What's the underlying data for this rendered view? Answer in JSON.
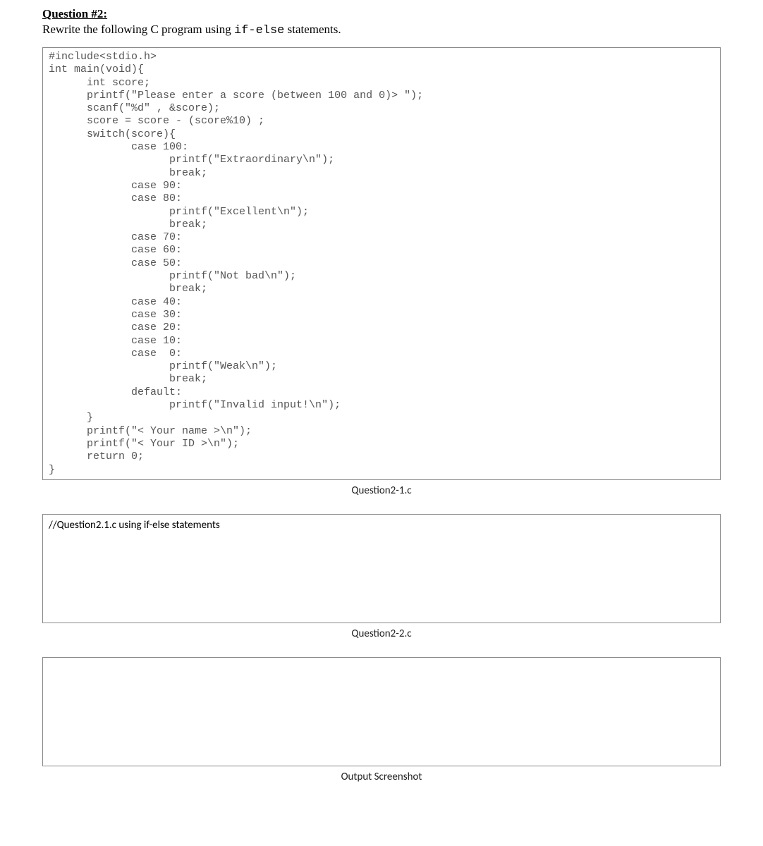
{
  "question": {
    "title": "Question #2:",
    "instruction_prefix": "Rewrite the following C program using ",
    "instruction_mono": "if-else",
    "instruction_suffix": " statements."
  },
  "code_block": "#include<stdio.h>\nint main(void){\n      int score;\n      printf(\"Please enter a score (between 100 and 0)> \");\n      scanf(\"%d\" , &score);\n      score = score - (score%10) ;\n      switch(score){\n             case 100:\n                   printf(\"Extraordinary\\n\");\n                   break;\n             case 90:\n             case 80:\n                   printf(\"Excellent\\n\");\n                   break;\n             case 70:\n             case 60:\n             case 50:\n                   printf(\"Not bad\\n\");\n                   break;\n             case 40:\n             case 30:\n             case 20:\n             case 10:\n             case  0:\n                   printf(\"Weak\\n\");\n                   break;\n             default:\n                   printf(\"Invalid input!\\n\");\n      }\n      printf(\"< Your name >\\n\");\n      printf(\"< Your ID >\\n\");\n      return 0;\n}",
  "caption1": "Question2-1.c",
  "answer_box_text": "//Question2.1.c using if-else statements",
  "caption2": "Question2-2.c",
  "caption3": "Output Screenshot"
}
